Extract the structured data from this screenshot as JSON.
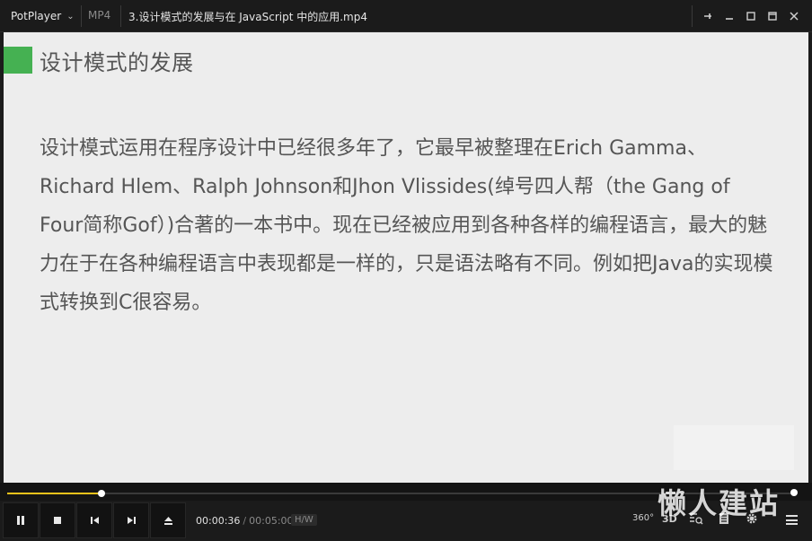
{
  "titlebar": {
    "app_name": "PotPlayer",
    "format": "MP4",
    "file_title": "3.设计模式的发展与在 JavaScript 中的应用.mp4"
  },
  "slide": {
    "heading": "设计模式的发展",
    "body": "设计模式运用在程序设计中已经很多年了，它最早被整理在Erich Gamma、Richard Hlem、Ralph Johnson和Jhon Vlissides(绰号四人帮（the Gang of Four简称Gof）)合著的一本书中。现在已经被应用到各种各样的编程语言，最大的魅力在于在各种编程语言中表现都是一样的，只是语法略有不同。例如把Java的实现模式转换到C很容易。",
    "accent_color": "#45b152"
  },
  "player": {
    "current_time": "00:00:36",
    "total_time": "00:05:00",
    "progress": 0.12,
    "hw_label": "H/W",
    "btn_360": "360°",
    "btn_3d": "3D",
    "progress_color": "#f2c21b"
  },
  "watermark": "懒人建站"
}
